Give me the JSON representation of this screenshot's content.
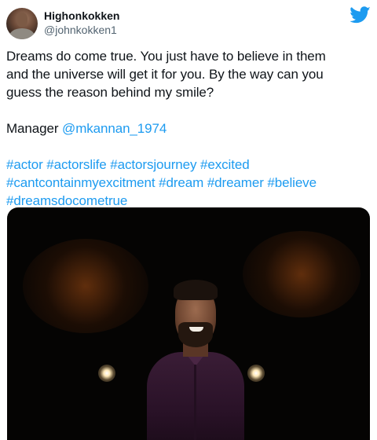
{
  "header": {
    "display_name": "Highonkokken",
    "handle": "@johnkokken1"
  },
  "tweet": {
    "line1": "Dreams do come true. You just have to believe in them",
    "line2": "and the universe will get it for you. By the way can you",
    "line3": "guess the reason behind my smile?",
    "manager_label": "Manager ",
    "manager_mention": "@mkannan_1974",
    "hashtags": [
      "#actor",
      "#actorslife",
      "#actorsjourney",
      "#excited",
      "#cantcontainmyexcitment",
      "#dream",
      "#dreamer",
      "#believe",
      "#dreamsdocometrue"
    ]
  },
  "colors": {
    "link": "#1d9bf0",
    "text": "#0f1419",
    "secondary": "#536471"
  },
  "icons": {
    "brand": "twitter-bird-icon"
  }
}
